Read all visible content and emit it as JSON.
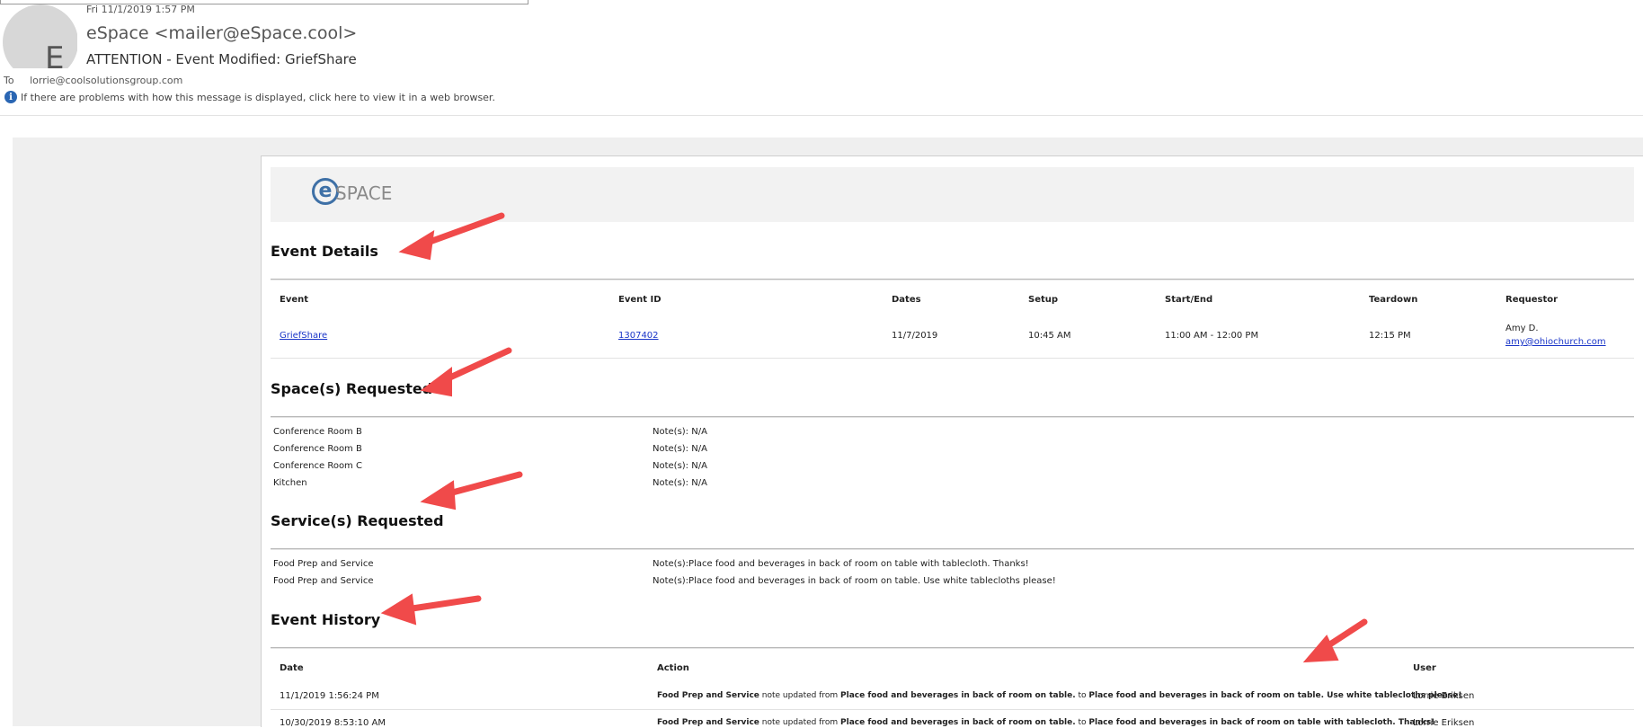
{
  "header": {
    "date": "Fri 11/1/2019 1:57 PM",
    "from": "eSpace <mailer@eSpace.cool>",
    "subject": "ATTENTION - Event Modified: GriefShare",
    "to_label": "To",
    "to": "lorrie@coolsolutionsgroup.com",
    "info_text": "If there are problems with how this message is displayed, click here to view it in a web browser.",
    "avatar_initial": "E"
  },
  "logo": {
    "mark": "e",
    "text": "SPACE"
  },
  "event_details": {
    "title": "Event Details",
    "columns": [
      "Event",
      "Event ID",
      "Dates",
      "Setup",
      "Start/End",
      "Teardown",
      "Requestor"
    ],
    "row": {
      "event": "GriefShare",
      "event_id": "1307402",
      "dates": "11/7/2019",
      "setup": "10:45 AM",
      "start_end": "11:00 AM - 12:00 PM",
      "teardown": "12:15 PM",
      "requestor_name": "Amy D.",
      "requestor_email": "amy@ohiochurch.com"
    }
  },
  "spaces": {
    "title": "Space(s) Requested",
    "items": [
      {
        "name": "Conference Room B",
        "note": "Note(s): N/A"
      },
      {
        "name": "Conference Room B",
        "note": "Note(s): N/A"
      },
      {
        "name": "Conference Room C",
        "note": "Note(s): N/A"
      },
      {
        "name": "Kitchen",
        "note": "Note(s): N/A"
      }
    ]
  },
  "services": {
    "title": "Service(s) Requested",
    "items": [
      {
        "name": "Food Prep and Service",
        "note": "Note(s):Place food and beverages in back of room on table with tablecloth. Thanks!"
      },
      {
        "name": "Food Prep and Service",
        "note": "Note(s):Place food and beverages in back of room on table. Use white tablecloths please!"
      }
    ]
  },
  "history": {
    "title": "Event History",
    "columns": [
      "Date",
      "Action",
      "User"
    ],
    "rows": [
      {
        "date": "11/1/2019 1:56:24 PM",
        "a1": "Food Prep and Service",
        "a2": " note updated from ",
        "a3": "Place food and beverages in back of room on table.",
        "a4": " to ",
        "a5": "Place food and beverages in back of room on table. Use white tablecloths please!",
        "user": "Lorrie Eriksen"
      },
      {
        "date": "10/30/2019 8:53:10 AM",
        "a1": "Food Prep and Service",
        "a2": " note updated from ",
        "a3": "Place food and beverages in back of room on table.",
        "a4": " to ",
        "a5": "Place food and beverages in back of room on table with tablecloth. Thanks!",
        "user": "Lorrie Eriksen"
      }
    ]
  },
  "colors": {
    "arrow": "#f04a4a",
    "link": "#1a35c8",
    "logo_blue": "#3e70a6",
    "info_blue": "#2a66b3"
  }
}
